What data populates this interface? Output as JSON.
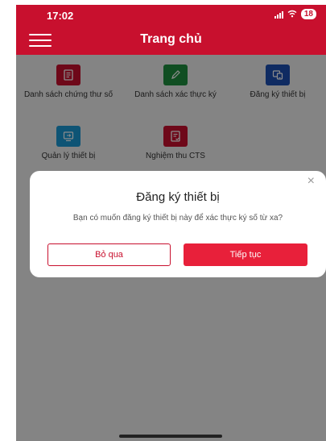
{
  "status_bar": {
    "time": "17:02",
    "battery": "18"
  },
  "header": {
    "title": "Trang chủ"
  },
  "menu": {
    "items": [
      {
        "label": "Danh sách chứng thư số",
        "color": "#c8102e",
        "icon": "document-icon"
      },
      {
        "label": "Danh sách xác thực ký",
        "color": "#1e8e3e",
        "icon": "pencil-icon"
      },
      {
        "label": "Đăng ký thiết bị",
        "color": "#1d4fb3",
        "icon": "devices-icon"
      },
      {
        "label": "Quản lý thiết bị",
        "color": "#1a9ad6",
        "icon": "device-manage-icon"
      },
      {
        "label": "Nghiệm thu CTS",
        "color": "#c8102e",
        "icon": "certificate-check-icon"
      }
    ]
  },
  "dialog": {
    "title": "Đăng ký thiết bị",
    "message": "Bạn có muốn đăng ký thiết bị này để xác thực ký số từ xa?",
    "skip_label": "Bỏ qua",
    "continue_label": "Tiếp tục",
    "close_glyph": "×"
  },
  "colors": {
    "brand": "#c8102e",
    "accent_button": "#e8203a"
  }
}
